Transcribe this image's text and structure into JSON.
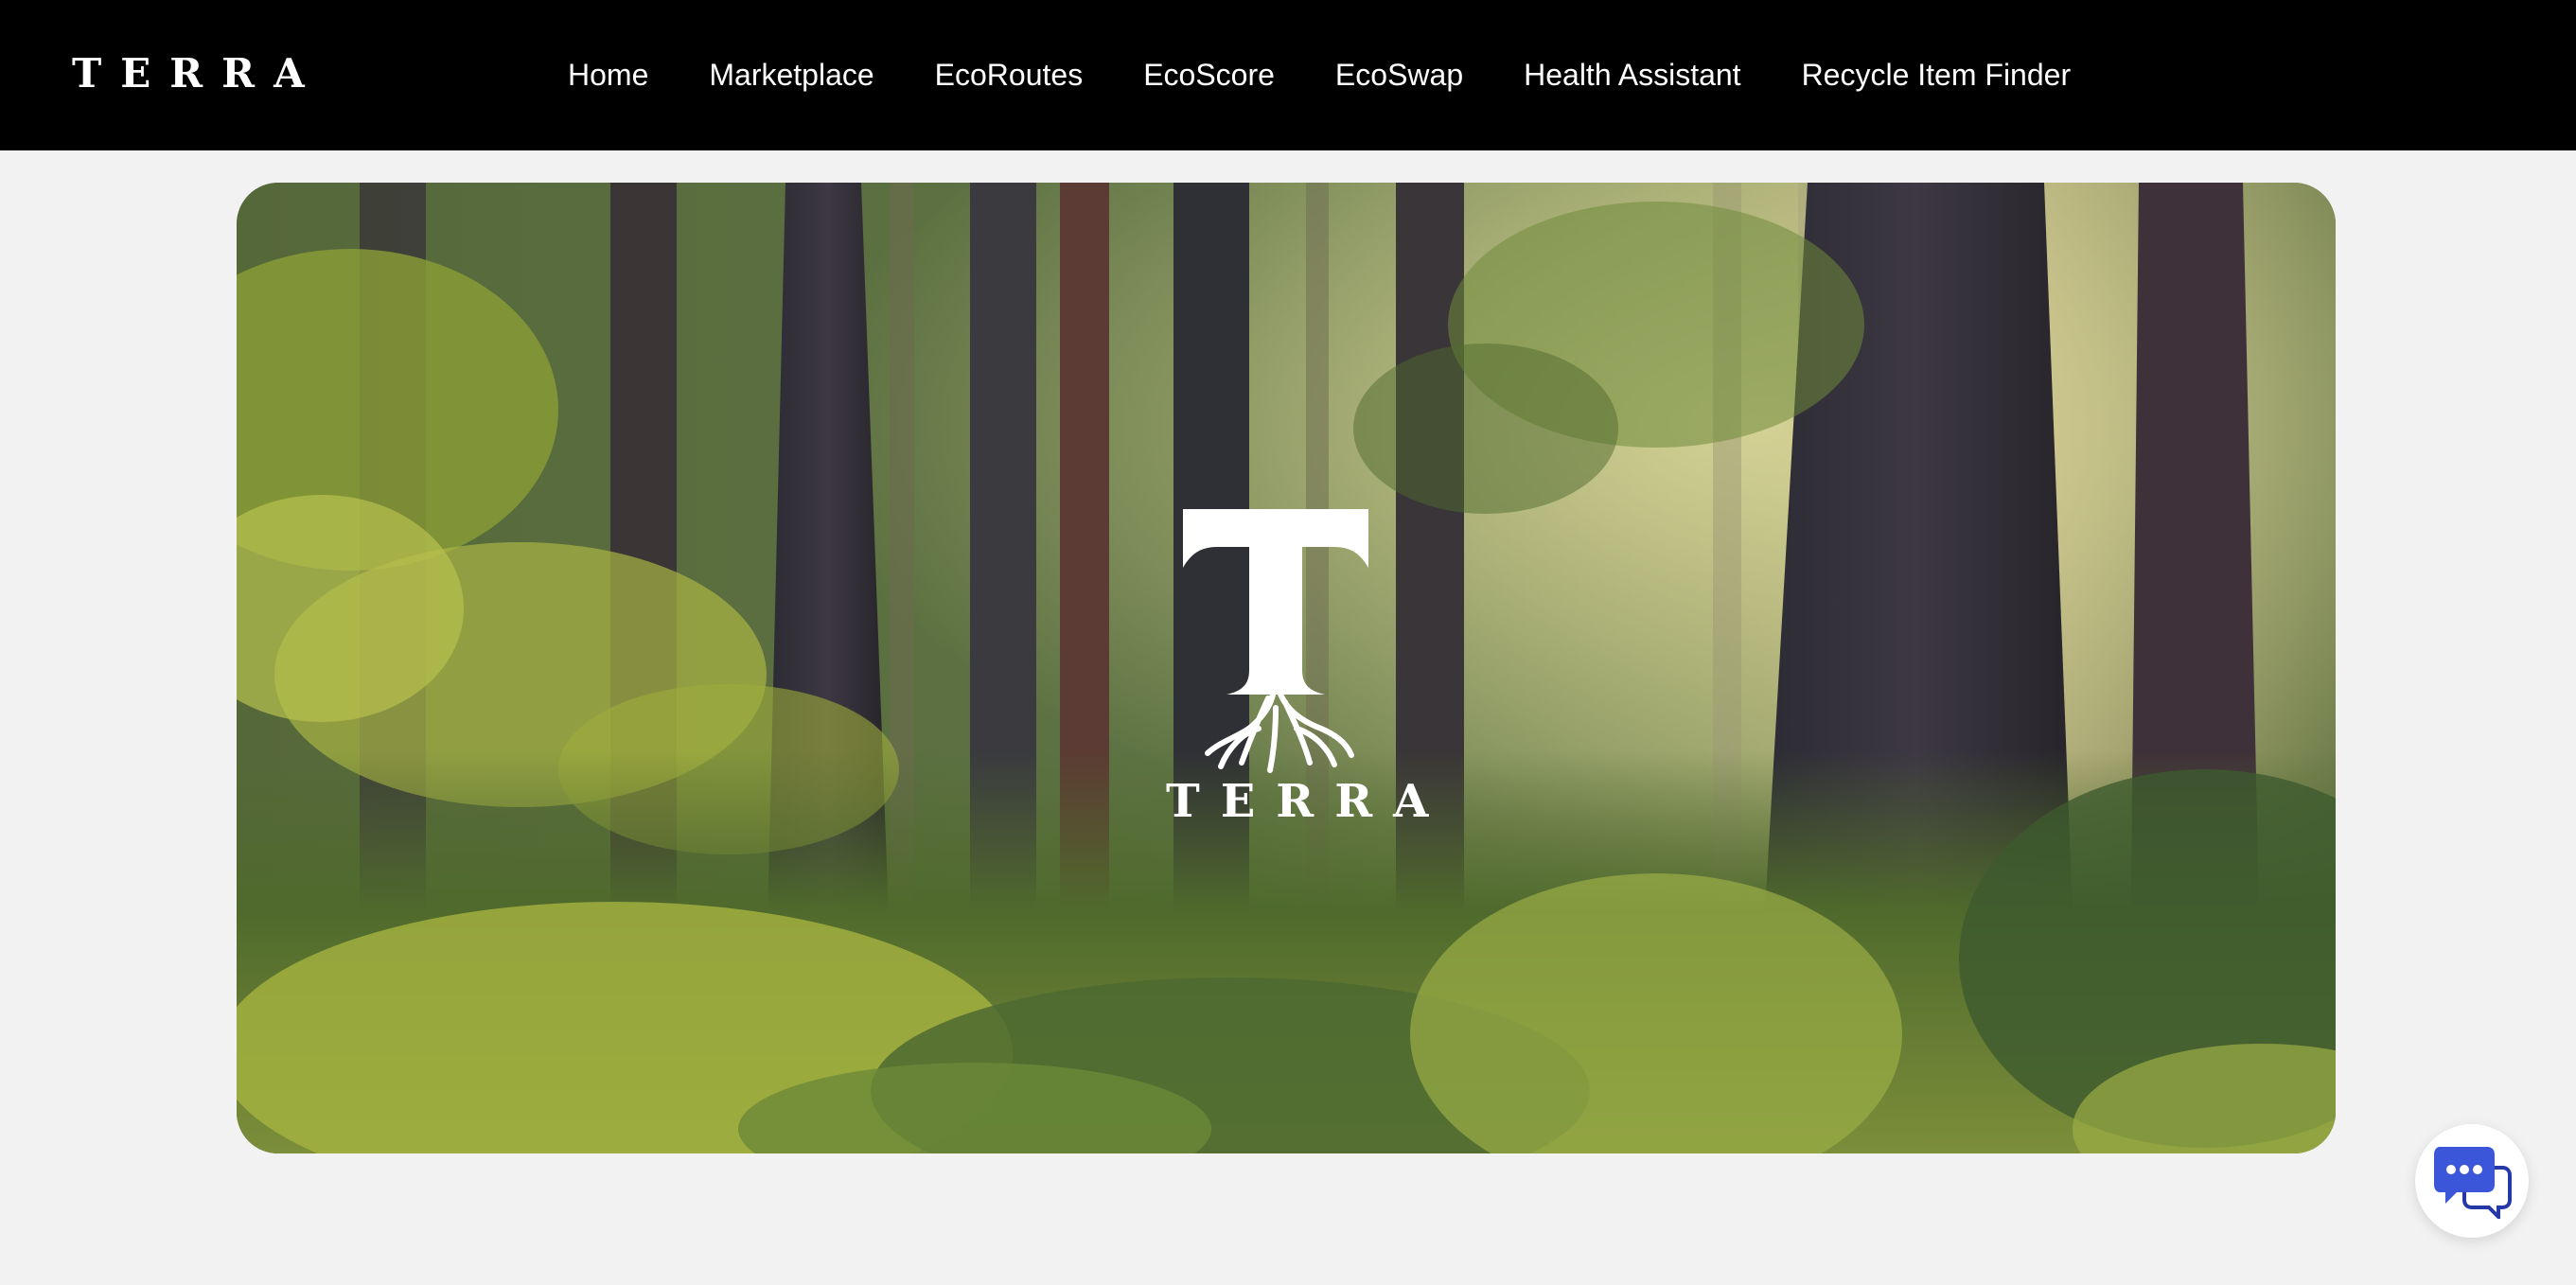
{
  "brand": {
    "name": "TERRA"
  },
  "nav": {
    "items": [
      {
        "label": "Home"
      },
      {
        "label": "Marketplace"
      },
      {
        "label": "EcoRoutes"
      },
      {
        "label": "EcoScore"
      },
      {
        "label": "EcoSwap"
      },
      {
        "label": "Health Assistant"
      },
      {
        "label": "Recycle Item Finder"
      }
    ]
  },
  "hero": {
    "logo_icon": "tree-root-t-icon",
    "title": "TERRA"
  },
  "chat": {
    "icon": "chat-bubbles-icon"
  },
  "colors": {
    "navbar_bg": "#000000",
    "page_bg": "#f2f2f2",
    "nav_text": "#ffffff",
    "chat_icon_primary": "#3b56d9",
    "chat_icon_secondary": "#2438a8"
  }
}
